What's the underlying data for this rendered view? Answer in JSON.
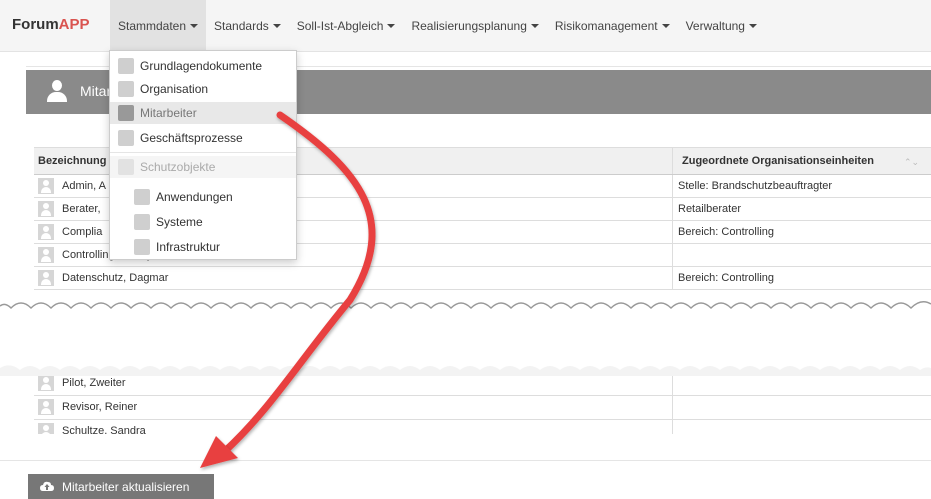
{
  "brand": {
    "forum": "Forum",
    "app": "APP"
  },
  "nav": [
    {
      "label": "Stammdaten",
      "active": true
    },
    {
      "label": "Standards"
    },
    {
      "label": "Soll-Ist-Abgleich"
    },
    {
      "label": "Realisierungsplanung"
    },
    {
      "label": "Risikomanagement"
    },
    {
      "label": "Verwaltung"
    }
  ],
  "header": {
    "title": "Mitarbeiter"
  },
  "table": {
    "col1": "Bezeichnung",
    "col2": "Zugeordnete Organisationseinheiten",
    "rows": [
      {
        "name": "Admin, A",
        "org": "Stelle: Brandschutzbeauftragter"
      },
      {
        "name": "Berater,",
        "org": "Retailberater"
      },
      {
        "name": "Complia",
        "org": "Bereich: Controlling"
      },
      {
        "name": "Controlling, Conny",
        "org": ""
      },
      {
        "name": "Datenschutz, Dagmar",
        "org": "Bereich: Controlling"
      }
    ],
    "rows2": [
      {
        "name": "Pilot, Zweiter",
        "org": ""
      },
      {
        "name": "Revisor, Reiner",
        "org": ""
      },
      {
        "name": "Schultze, Sandra",
        "org": ""
      }
    ]
  },
  "dropdown": {
    "items": [
      {
        "label": "Grundlagendokumente",
        "icon": "document-icon"
      },
      {
        "label": "Organisation",
        "icon": "org-chart-icon"
      },
      {
        "label": "Mitarbeiter",
        "icon": "user-icon"
      },
      {
        "label": "Geschäftsprozesse",
        "icon": "arrow-right-icon"
      },
      {
        "label": "Schutzobjekte",
        "icon": "list-icon"
      },
      {
        "label": "Anwendungen",
        "icon": "gear-icon"
      },
      {
        "label": "Systeme",
        "icon": "monitor-icon"
      },
      {
        "label": "Infrastruktur",
        "icon": "building-icon"
      }
    ]
  },
  "footer": {
    "update_label": "Mitarbeiter aktualisieren"
  },
  "colors": {
    "arrow": "#e8403f",
    "header_bg": "#8a8a8a"
  }
}
